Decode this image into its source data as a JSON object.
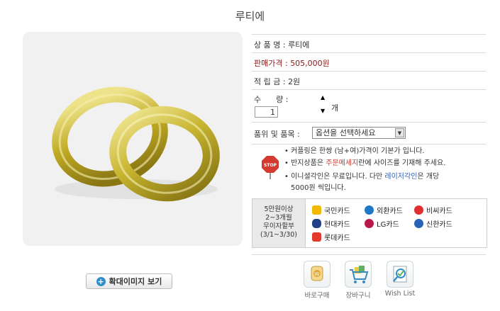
{
  "product": {
    "title": "루티에"
  },
  "image_button": {
    "label": "확대이미지 보기"
  },
  "info": {
    "name_label": "상 품 명 : ",
    "name_value": "루티에",
    "price_label": "판매가격 : ",
    "price_value": "505,000원",
    "points_label": "적 립 금 : ",
    "points_value": "2원",
    "qty_label": "수      량 :",
    "qty_value": "1",
    "qty_unit": "개",
    "option_label": "품위 및 품목 :",
    "option_selected": "옵션을 선택하세요"
  },
  "notes": {
    "stop_sign": "STOP",
    "line1": "• 커플링은 한쌍 (남+여)가격이 기본가 입니다.",
    "line2_a": "• 반지상품은 ",
    "line2_b": "주문메세지",
    "line2_c": "란에 사이즈를 기재해 주세요.",
    "line3_a": "• 이니셜각인은 무료입니다. 다만 ",
    "line3_b": "레이저각인",
    "line3_c": "은 개당",
    "line4": "5000원 씩입니다."
  },
  "installment": {
    "line1": "5만원이상",
    "line2": "2~3개월",
    "line3": "무이자할부",
    "line4": "(3/1~3/30)",
    "cards": [
      "국민카드",
      "외환카드",
      "비씨카드",
      "현대카드",
      "LG카드",
      "신한카드",
      "롯데카드"
    ]
  },
  "actions": {
    "buy_now": "바로구매",
    "cart": "장바구니",
    "wishlist": "Wish List"
  },
  "colors": {
    "price": "#8b1a1a",
    "highlight_red": "#c8372d",
    "highlight_blue": "#2f5fb3"
  }
}
